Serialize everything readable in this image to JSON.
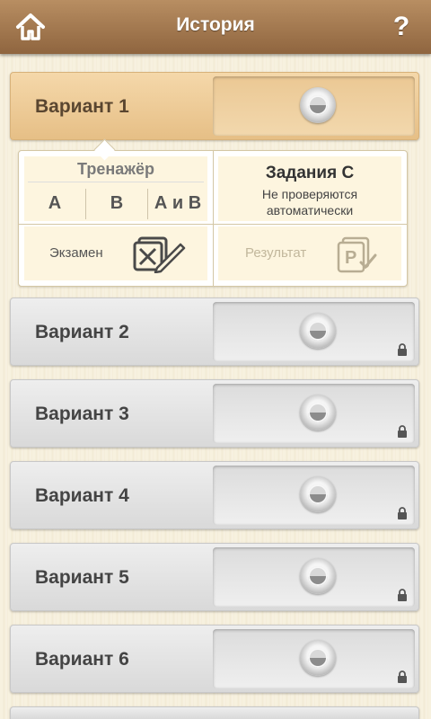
{
  "header": {
    "title": "История",
    "help": "?"
  },
  "variants": [
    {
      "label": "Вариант 1",
      "locked": false
    },
    {
      "label": "Вариант 2",
      "locked": true
    },
    {
      "label": "Вариант 3",
      "locked": true
    },
    {
      "label": "Вариант 4",
      "locked": true
    },
    {
      "label": "Вариант 5",
      "locked": true
    },
    {
      "label": "Вариант 6",
      "locked": true
    }
  ],
  "detail": {
    "trainer_title": "Тренажёр",
    "trainer_options": [
      "А",
      "В",
      "А и В"
    ],
    "tasks_title": "Задания С",
    "tasks_note_line1": "Не проверяются",
    "tasks_note_line2": "автоматически",
    "exam_label": "Экзамен",
    "result_label": "Результат"
  },
  "icons": {
    "home": "home-icon",
    "help": "help-icon",
    "disk": "disk-icon",
    "lock": "lock-icon",
    "exam": "exam-sheet-pencil-icon",
    "result": "result-sheet-check-icon"
  }
}
